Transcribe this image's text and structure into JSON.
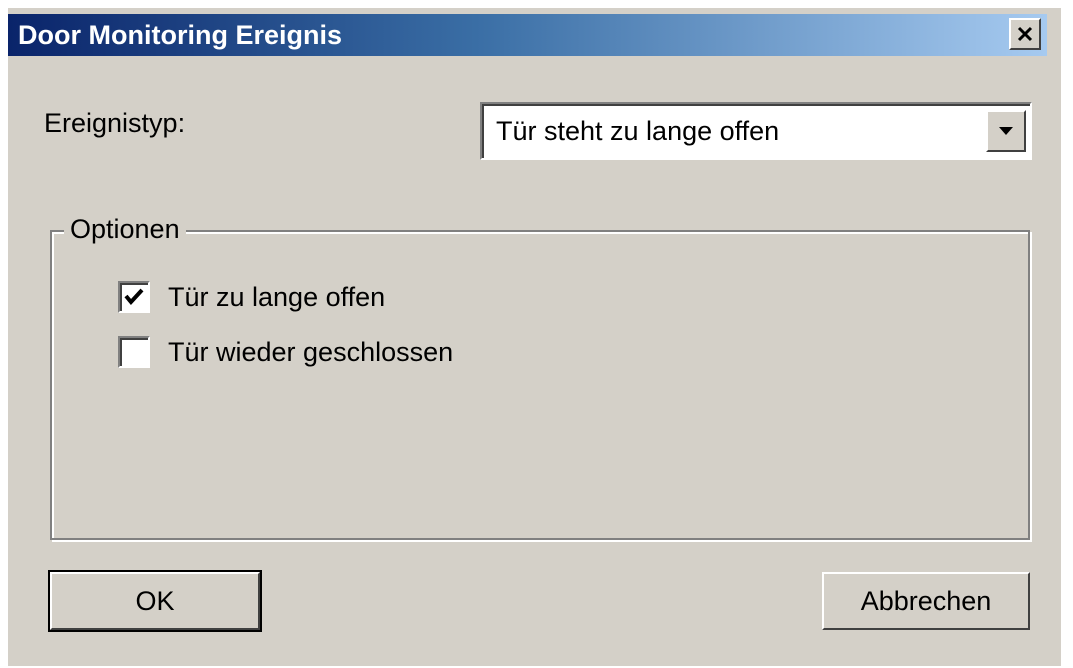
{
  "window": {
    "title": "Door Monitoring Ereignis",
    "close_icon": "close-icon"
  },
  "event_type": {
    "label": "Ereignistyp:",
    "selected": "Tür steht zu lange offen",
    "dropdown_icon": "chevron-down-icon"
  },
  "options": {
    "legend": "Optionen",
    "items": [
      {
        "label": "Tür zu lange offen",
        "checked": true
      },
      {
        "label": "Tür wieder geschlossen",
        "checked": false
      }
    ]
  },
  "buttons": {
    "ok": "OK",
    "cancel": "Abbrechen"
  },
  "colors": {
    "titlebar_start": "#0a246a",
    "titlebar_end": "#a6caf0",
    "dialog_bg": "#d4d0c8"
  }
}
